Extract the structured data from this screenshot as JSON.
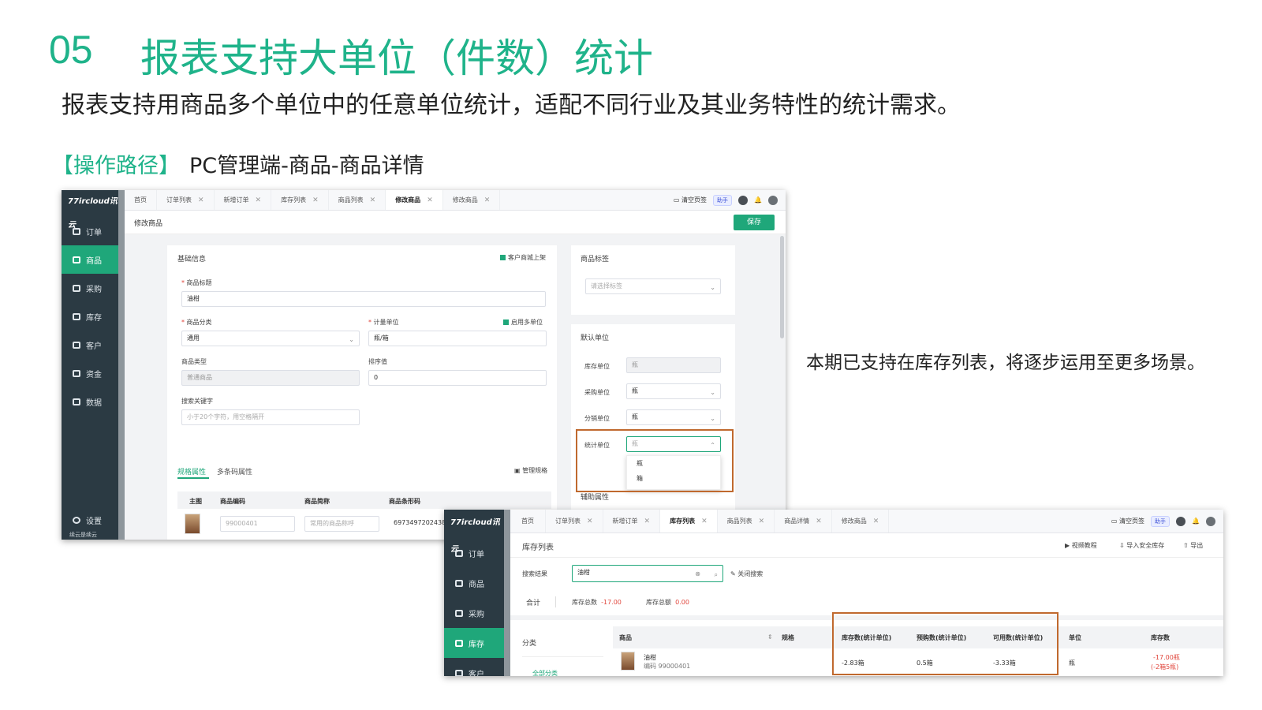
{
  "slide": {
    "number": "05",
    "title": "报表支持大单位（件数）统计",
    "subtitle": "报表支持用商品多个单位中的任意单位统计，适配不同行业及其业务特性的统计需求。",
    "path_label": "【操作路径】",
    "path_value": "PC管理端-商品-商品详情",
    "note": "本期已支持在库存列表，将逐步运用至更多场景。"
  },
  "colors": {
    "accent": "#1fb38a",
    "sidebar": "#2b3a43",
    "active": "#1fa77a",
    "highlight": "#c0692e",
    "negative": "#e0453b"
  },
  "sidebar": {
    "logo": "77ircloud讯云",
    "items": [
      {
        "label": "订单",
        "icon": "order-icon"
      },
      {
        "label": "商品",
        "icon": "goods-icon"
      },
      {
        "label": "采购",
        "icon": "cart-icon"
      },
      {
        "label": "库存",
        "icon": "inventory-icon"
      },
      {
        "label": "客户",
        "icon": "user-icon"
      },
      {
        "label": "资金",
        "icon": "shield-icon"
      },
      {
        "label": "数据",
        "icon": "data-icon"
      }
    ],
    "settings": "设置"
  },
  "toolbar": {
    "clear": "清空页签",
    "helper": "助手"
  },
  "win1": {
    "tabs": [
      "首页",
      "订单列表",
      "新增订单",
      "库存列表",
      "商品列表",
      "修改商品",
      "修改商品"
    ],
    "page_title": "修改商品",
    "save": "保存",
    "basic": {
      "heading": "基础信息",
      "on_shelf": "客户商城上架",
      "title_label": "商品标题",
      "title_value": "油柑",
      "category_label": "商品分类",
      "category_value": "通用",
      "unit_label": "计量单位",
      "unit_value": "瓶/箱",
      "multi_unit": "启用多单位",
      "type_label": "商品类型",
      "type_value": "普通商品",
      "sort_label": "排序值",
      "sort_value": "0",
      "keyword_label": "搜索关键字",
      "keyword_placeholder": "小于20个字符，用空格隔开"
    },
    "tags": {
      "heading": "商品标签",
      "placeholder": "请选择标签"
    },
    "units": {
      "heading": "默认单位",
      "stock_label": "库存单位",
      "stock_value": "瓶",
      "purchase_label": "采购单位",
      "purchase_value": "瓶",
      "dist_label": "分销单位",
      "dist_value": "瓶",
      "stat_label": "统计单位",
      "stat_value": "瓶",
      "options": [
        "瓶",
        "箱"
      ]
    },
    "aux": "辅助属性",
    "spec": {
      "tab_active": "规格属性",
      "tab_other": "多条码属性",
      "manage": "管理规格",
      "headers": [
        "主图",
        "商品编码",
        "商品简称",
        "商品条形码"
      ],
      "code_placeholder": "99000401",
      "name_placeholder": "常用的商品称呼",
      "barcode": "6973497202438"
    },
    "footer": "续云是续云"
  },
  "win2": {
    "tabs": [
      "首页",
      "订单列表",
      "新增订单",
      "库存列表",
      "商品列表",
      "商品详情",
      "修改商品"
    ],
    "page_title": "库存列表",
    "actions": [
      "视频教程",
      "导入安全库存",
      "导出"
    ],
    "search_label": "搜索结果",
    "search_value": "油柑",
    "close_search": "关闭搜索",
    "summary": {
      "label": "合计",
      "stock_label": "库存总数",
      "stock_value": "-17.00",
      "amount_label": "库存总额",
      "amount_value": "0.00"
    },
    "category": "分类",
    "all_category": "全部分类",
    "headers": [
      "商品",
      "规格",
      "库存数(统计单位)",
      "预购数(统计单位)",
      "可用数(统计单位)",
      "单位",
      "库存数"
    ],
    "row": {
      "name": "油柑",
      "code": "编码 99000401",
      "stock_stat": "-2.83箱",
      "pre_stat": "0.5箱",
      "avail_stat": "-3.33箱",
      "unit": "瓶",
      "stock": "-17.00瓶",
      "stock_detail": "(-2箱5瓶)"
    }
  }
}
